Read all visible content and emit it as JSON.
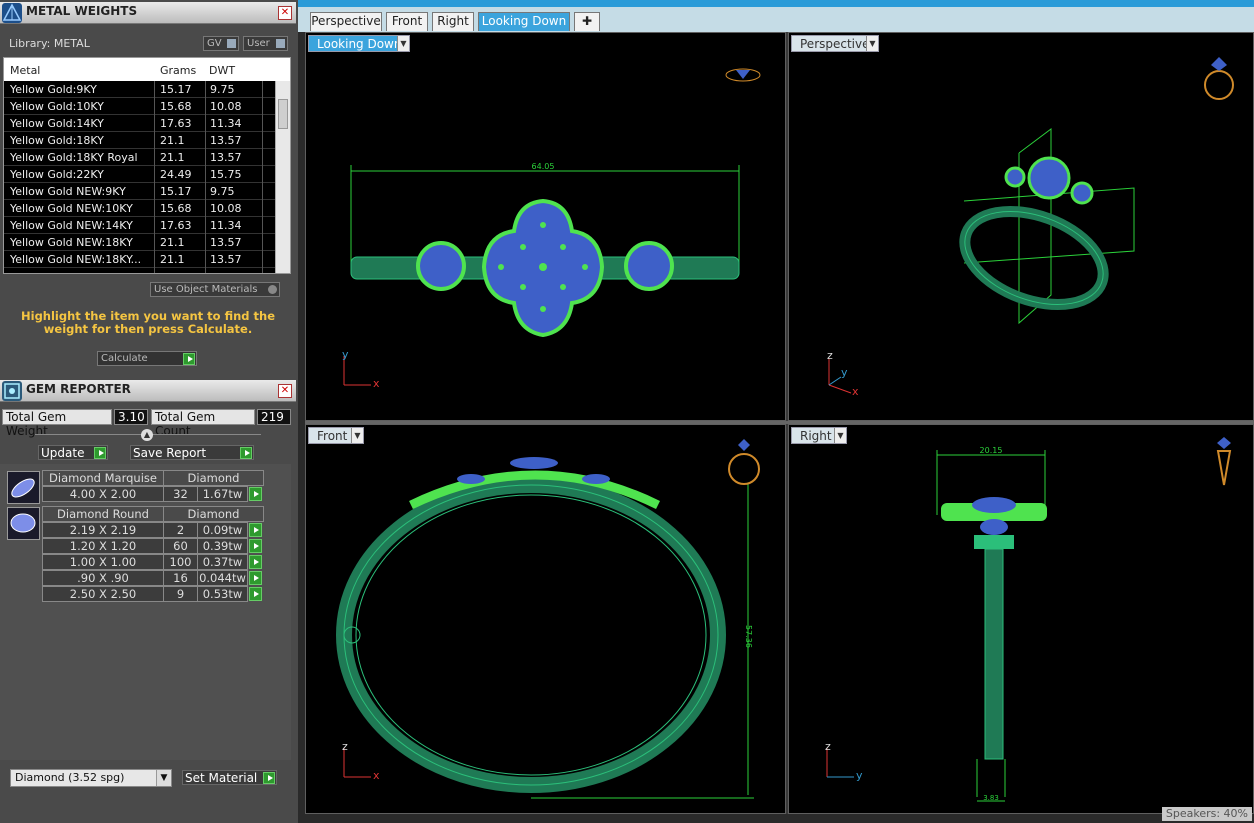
{
  "metal_panel": {
    "title": "METAL WEIGHTS",
    "library_label": "Library: METAL",
    "gv_label": "GV",
    "user_label": "User",
    "columns": [
      "Metal",
      "Grams",
      "DWT"
    ],
    "rows": [
      {
        "metal": "Yellow Gold:9KY",
        "grams": "15.17",
        "dwt": "9.75"
      },
      {
        "metal": "Yellow Gold:10KY",
        "grams": "15.68",
        "dwt": "10.08"
      },
      {
        "metal": "Yellow Gold:14KY",
        "grams": "17.63",
        "dwt": "11.34"
      },
      {
        "metal": "Yellow Gold:18KY",
        "grams": "21.1",
        "dwt": "13.57"
      },
      {
        "metal": "Yellow Gold:18KY Royal",
        "grams": "21.1",
        "dwt": "13.57"
      },
      {
        "metal": "Yellow Gold:22KY",
        "grams": "24.49",
        "dwt": "15.75"
      },
      {
        "metal": "Yellow Gold NEW:9KY",
        "grams": "15.17",
        "dwt": "9.75"
      },
      {
        "metal": "Yellow Gold NEW:10KY",
        "grams": "15.68",
        "dwt": "10.08"
      },
      {
        "metal": "Yellow Gold NEW:14KY",
        "grams": "17.63",
        "dwt": "11.34"
      },
      {
        "metal": "Yellow Gold NEW:18KY",
        "grams": "21.1",
        "dwt": "13.57"
      },
      {
        "metal": "Yellow Gold NEW:18KY...",
        "grams": "21.1",
        "dwt": "13.57"
      }
    ],
    "use_object_materials": "Use Object Materials",
    "hint": "Highlight the item you want to find the weight for then press Calculate.",
    "calculate": "Calculate"
  },
  "gem_panel": {
    "title": "GEM REPORTER",
    "total_weight_label": "Total Gem Weight",
    "total_weight": "3.10",
    "total_count_label": "Total Gem Count",
    "total_count": "219",
    "update": "Update",
    "save_report": "Save Report",
    "groups": [
      {
        "shape": "Diamond Marquise",
        "material": "Diamond",
        "sizes": [
          {
            "size": "4.00 X 2.00",
            "count": "32",
            "weight": "1.67tw"
          }
        ]
      },
      {
        "shape": "Diamond Round",
        "material": "Diamond",
        "sizes": [
          {
            "size": "2.19 X 2.19",
            "count": "2",
            "weight": "0.09tw"
          },
          {
            "size": "1.20 X 1.20",
            "count": "60",
            "weight": "0.39tw"
          },
          {
            "size": "1.00 X 1.00",
            "count": "100",
            "weight": "0.37tw"
          },
          {
            "size": ".90 X .90",
            "count": "16",
            "weight": "0.044tw"
          },
          {
            "size": "2.50 X 2.50",
            "count": "9",
            "weight": "0.53tw"
          }
        ]
      }
    ],
    "material_select": "Diamond     (3.52 spg)",
    "set_material": "Set Material"
  },
  "tabs": [
    "Perspective",
    "Front",
    "Right",
    "Looking Down"
  ],
  "viewports": [
    {
      "label": "Looking Down",
      "axis_a": "y",
      "axis_b": "x",
      "dimension": "64.05"
    },
    {
      "label": "Perspective",
      "axis_a": "z",
      "axis_b": "y",
      "axis_c": "x"
    },
    {
      "label": "Front",
      "axis_a": "z",
      "axis_b": "x",
      "dimension": "57.36"
    },
    {
      "label": "Right",
      "axis_a": "z",
      "axis_b": "y",
      "dimension": "20.15",
      "dimension2": "3.83"
    }
  ],
  "status": "Speakers: 40%",
  "colors": {
    "accent": "#3ba4dd",
    "wire": "#2bbf7a",
    "gem": "#4b6fd8",
    "prong": "#4fe34f",
    "hint": "#f5c542"
  }
}
